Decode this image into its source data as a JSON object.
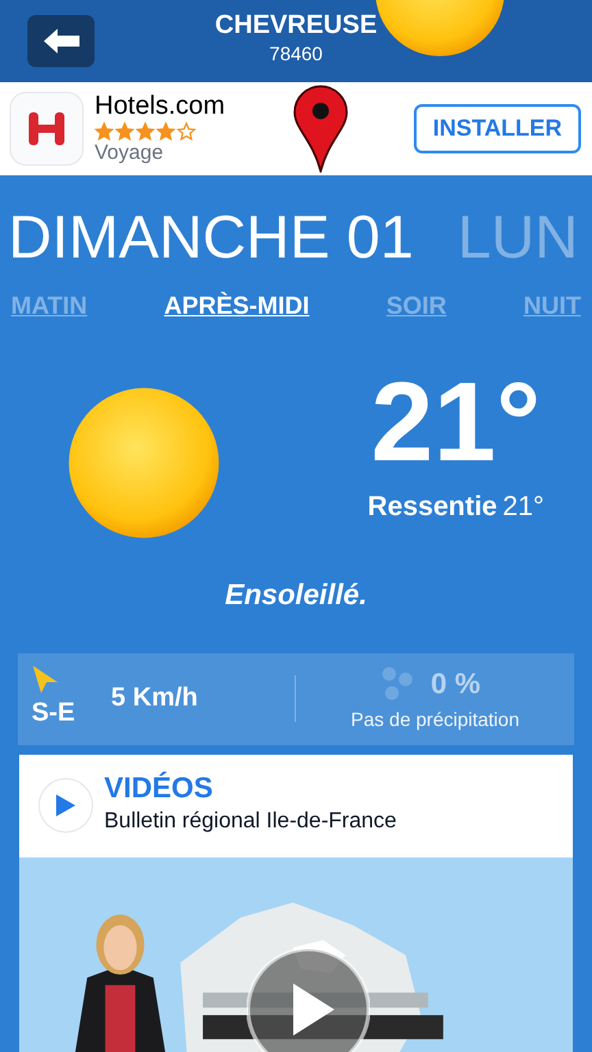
{
  "header": {
    "city": "CHEVREUSE",
    "postcode": "78460"
  },
  "ad": {
    "app_name": "Hotels.com",
    "stars": 4,
    "category": "Voyage",
    "button": "INSTALLER"
  },
  "days": [
    {
      "label": "DIMANCHE 01",
      "selected": true
    },
    {
      "label": "LUN",
      "selected": false
    }
  ],
  "periods": [
    {
      "label": "MATIN",
      "selected": false
    },
    {
      "label": "APRÈS-MIDI",
      "selected": true
    },
    {
      "label": "SOIR",
      "selected": false
    },
    {
      "label": "NUIT",
      "selected": false
    }
  ],
  "current": {
    "temperature": "21°",
    "feels_label": "Ressentie",
    "feels_value": "21°",
    "condition": "Ensoleillé."
  },
  "wind": {
    "direction": "S-E",
    "speed": "5 Km/h"
  },
  "precipitation": {
    "value": "0 %",
    "label": "Pas de précipitation"
  },
  "videos": {
    "title": "VIDÉOS",
    "subtitle": "Bulletin régional Ile-de-France"
  }
}
